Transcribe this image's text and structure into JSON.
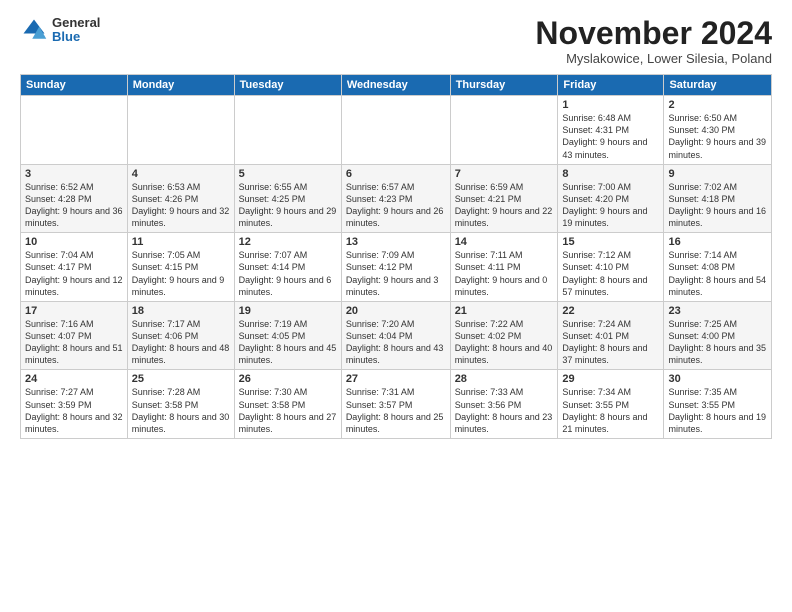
{
  "logo": {
    "general": "General",
    "blue": "Blue"
  },
  "title": "November 2024",
  "subtitle": "Myslakowice, Lower Silesia, Poland",
  "days_of_week": [
    "Sunday",
    "Monday",
    "Tuesday",
    "Wednesday",
    "Thursday",
    "Friday",
    "Saturday"
  ],
  "weeks": [
    [
      {
        "day": "",
        "detail": ""
      },
      {
        "day": "",
        "detail": ""
      },
      {
        "day": "",
        "detail": ""
      },
      {
        "day": "",
        "detail": ""
      },
      {
        "day": "",
        "detail": ""
      },
      {
        "day": "1",
        "detail": "Sunrise: 6:48 AM\nSunset: 4:31 PM\nDaylight: 9 hours and 43 minutes."
      },
      {
        "day": "2",
        "detail": "Sunrise: 6:50 AM\nSunset: 4:30 PM\nDaylight: 9 hours and 39 minutes."
      }
    ],
    [
      {
        "day": "3",
        "detail": "Sunrise: 6:52 AM\nSunset: 4:28 PM\nDaylight: 9 hours and 36 minutes."
      },
      {
        "day": "4",
        "detail": "Sunrise: 6:53 AM\nSunset: 4:26 PM\nDaylight: 9 hours and 32 minutes."
      },
      {
        "day": "5",
        "detail": "Sunrise: 6:55 AM\nSunset: 4:25 PM\nDaylight: 9 hours and 29 minutes."
      },
      {
        "day": "6",
        "detail": "Sunrise: 6:57 AM\nSunset: 4:23 PM\nDaylight: 9 hours and 26 minutes."
      },
      {
        "day": "7",
        "detail": "Sunrise: 6:59 AM\nSunset: 4:21 PM\nDaylight: 9 hours and 22 minutes."
      },
      {
        "day": "8",
        "detail": "Sunrise: 7:00 AM\nSunset: 4:20 PM\nDaylight: 9 hours and 19 minutes."
      },
      {
        "day": "9",
        "detail": "Sunrise: 7:02 AM\nSunset: 4:18 PM\nDaylight: 9 hours and 16 minutes."
      }
    ],
    [
      {
        "day": "10",
        "detail": "Sunrise: 7:04 AM\nSunset: 4:17 PM\nDaylight: 9 hours and 12 minutes."
      },
      {
        "day": "11",
        "detail": "Sunrise: 7:05 AM\nSunset: 4:15 PM\nDaylight: 9 hours and 9 minutes."
      },
      {
        "day": "12",
        "detail": "Sunrise: 7:07 AM\nSunset: 4:14 PM\nDaylight: 9 hours and 6 minutes."
      },
      {
        "day": "13",
        "detail": "Sunrise: 7:09 AM\nSunset: 4:12 PM\nDaylight: 9 hours and 3 minutes."
      },
      {
        "day": "14",
        "detail": "Sunrise: 7:11 AM\nSunset: 4:11 PM\nDaylight: 9 hours and 0 minutes."
      },
      {
        "day": "15",
        "detail": "Sunrise: 7:12 AM\nSunset: 4:10 PM\nDaylight: 8 hours and 57 minutes."
      },
      {
        "day": "16",
        "detail": "Sunrise: 7:14 AM\nSunset: 4:08 PM\nDaylight: 8 hours and 54 minutes."
      }
    ],
    [
      {
        "day": "17",
        "detail": "Sunrise: 7:16 AM\nSunset: 4:07 PM\nDaylight: 8 hours and 51 minutes."
      },
      {
        "day": "18",
        "detail": "Sunrise: 7:17 AM\nSunset: 4:06 PM\nDaylight: 8 hours and 48 minutes."
      },
      {
        "day": "19",
        "detail": "Sunrise: 7:19 AM\nSunset: 4:05 PM\nDaylight: 8 hours and 45 minutes."
      },
      {
        "day": "20",
        "detail": "Sunrise: 7:20 AM\nSunset: 4:04 PM\nDaylight: 8 hours and 43 minutes."
      },
      {
        "day": "21",
        "detail": "Sunrise: 7:22 AM\nSunset: 4:02 PM\nDaylight: 8 hours and 40 minutes."
      },
      {
        "day": "22",
        "detail": "Sunrise: 7:24 AM\nSunset: 4:01 PM\nDaylight: 8 hours and 37 minutes."
      },
      {
        "day": "23",
        "detail": "Sunrise: 7:25 AM\nSunset: 4:00 PM\nDaylight: 8 hours and 35 minutes."
      }
    ],
    [
      {
        "day": "24",
        "detail": "Sunrise: 7:27 AM\nSunset: 3:59 PM\nDaylight: 8 hours and 32 minutes."
      },
      {
        "day": "25",
        "detail": "Sunrise: 7:28 AM\nSunset: 3:58 PM\nDaylight: 8 hours and 30 minutes."
      },
      {
        "day": "26",
        "detail": "Sunrise: 7:30 AM\nSunset: 3:58 PM\nDaylight: 8 hours and 27 minutes."
      },
      {
        "day": "27",
        "detail": "Sunrise: 7:31 AM\nSunset: 3:57 PM\nDaylight: 8 hours and 25 minutes."
      },
      {
        "day": "28",
        "detail": "Sunrise: 7:33 AM\nSunset: 3:56 PM\nDaylight: 8 hours and 23 minutes."
      },
      {
        "day": "29",
        "detail": "Sunrise: 7:34 AM\nSunset: 3:55 PM\nDaylight: 8 hours and 21 minutes."
      },
      {
        "day": "30",
        "detail": "Sunrise: 7:35 AM\nSunset: 3:55 PM\nDaylight: 8 hours and 19 minutes."
      }
    ]
  ]
}
